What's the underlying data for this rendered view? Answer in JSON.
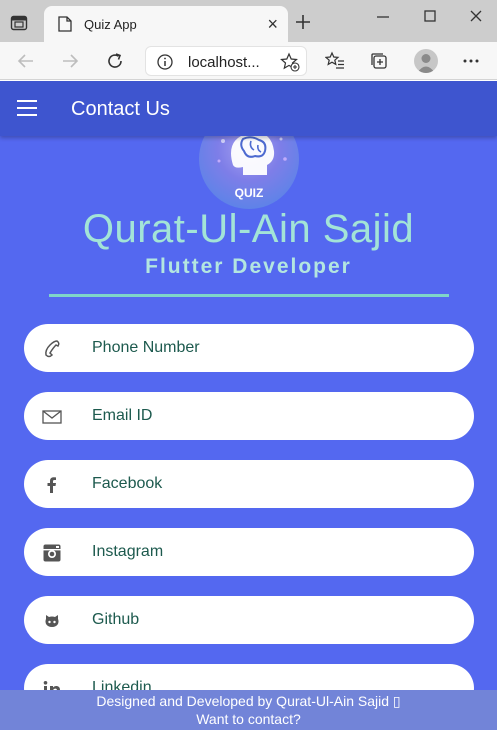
{
  "browser": {
    "tab_title": "Quiz App",
    "tab_close": "×",
    "url": "localhost..."
  },
  "app": {
    "appbar_title": "Contact Us",
    "logo_text": "QUIZ",
    "name": "Qurat-Ul-Ain Sajid",
    "role": "Flutter Developer",
    "contacts": [
      {
        "label": "Phone Number",
        "icon": "phone-icon"
      },
      {
        "label": "Email ID",
        "icon": "email-icon"
      },
      {
        "label": "Facebook",
        "icon": "facebook-icon"
      },
      {
        "label": "Instagram",
        "icon": "instagram-icon"
      },
      {
        "label": "Github",
        "icon": "github-icon"
      },
      {
        "label": "Linkedin",
        "icon": "linkedin-icon"
      }
    ],
    "footer": {
      "line1": "Designed and Developed by Qurat-Ul-Ain Sajid ▯",
      "line2": "Want to contact?"
    }
  },
  "colors": {
    "app_background": "#5468f0",
    "appbar": "#3e55cf",
    "name_text": "#a3e4d7",
    "card_text": "#1d5a4e",
    "footer": "#7284d8"
  }
}
